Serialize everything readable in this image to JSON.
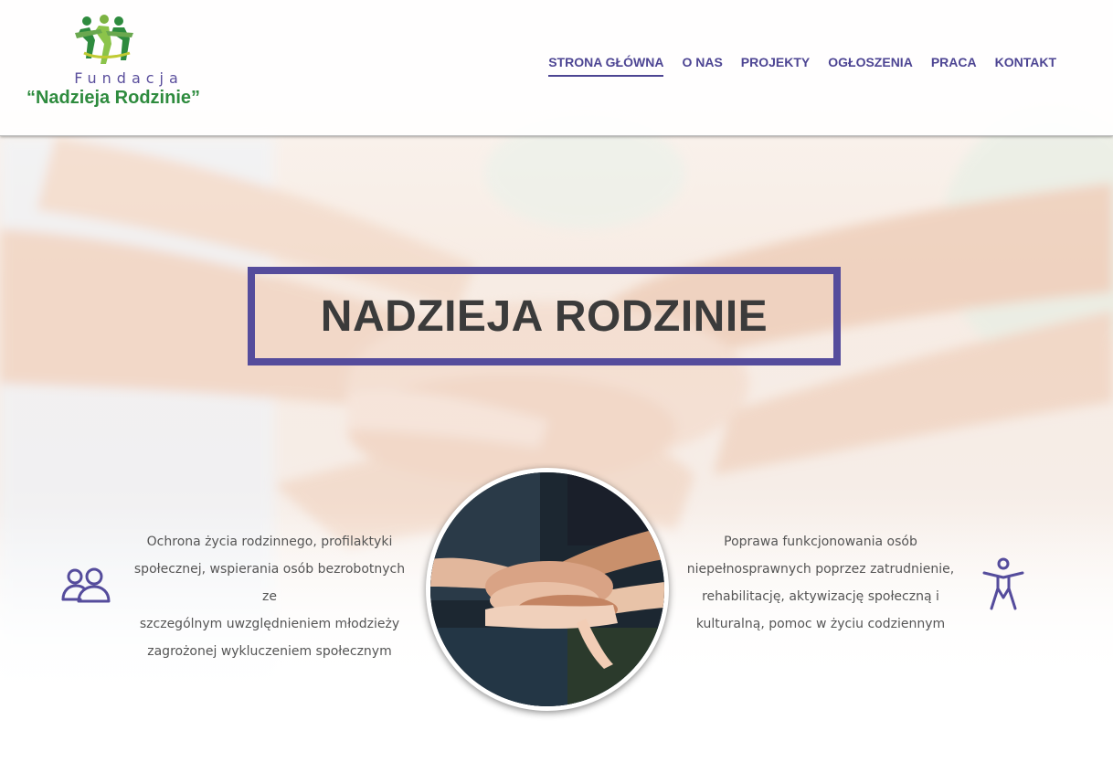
{
  "logo": {
    "line1": "Fundacja",
    "line2": "“Nadzieja Rodzinie”"
  },
  "nav": {
    "items": [
      {
        "label": "STRONA GŁÓWNA",
        "active": true
      },
      {
        "label": "O NAS",
        "active": false
      },
      {
        "label": "PROJEKTY",
        "active": false
      },
      {
        "label": "OGŁOSZENIA",
        "active": false
      },
      {
        "label": "PRACA",
        "active": false
      },
      {
        "label": "KONTAKT",
        "active": false
      }
    ]
  },
  "hero": {
    "title": "NADZIEJA RODZINIE"
  },
  "features": {
    "left": {
      "icon": "people-icon",
      "lines": [
        "Ochrona życia rodzinnego, profilaktyki",
        "społecznej, wspierania osób bezrobotnych ze",
        "szczególnym uwzględnieniem młodzieży",
        "zagrożonej wykluczeniem społecznym"
      ]
    },
    "right": {
      "icon": "accessibility-icon",
      "lines": [
        "Poprawa funkcjonowania osób",
        "niepełnosprawnych poprzez zatrudnienie,",
        "rehabilitację, aktywizację społeczną i",
        "kulturalną, pomoc w życiu codziennym"
      ]
    }
  },
  "colors": {
    "accent": "#554c9c",
    "nav_text": "#4d4593",
    "logo_green": "#2e8b3e",
    "title_text": "#3b3b3b"
  }
}
